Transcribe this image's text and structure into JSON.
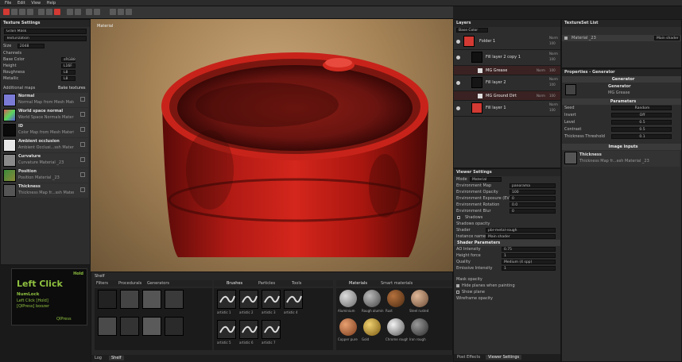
{
  "menu": [
    "File",
    "Edit",
    "View",
    "Help"
  ],
  "left_panel": {
    "title": "Texture Settings",
    "rows": [
      "Grain Mask",
      "Texturization"
    ],
    "size_label": "Size",
    "size_value": "2048",
    "channels_label": "Channels",
    "channels": [
      {
        "label": "Base Color",
        "value": "sRGB8"
      },
      {
        "label": "Height",
        "value": "L16F"
      },
      {
        "label": "Roughness",
        "value": "L8"
      },
      {
        "label": "Metallic",
        "value": "L8"
      }
    ],
    "maps_label": "Additional maps",
    "bake_button": "Bake textures",
    "maps": [
      {
        "name": "Normal",
        "sub": "Normal Map from Mesh Material _23"
      },
      {
        "name": "World space normal",
        "sub": "World Space Normals Material _23"
      },
      {
        "name": "ID",
        "sub": "Color Map from Mesh Material _23"
      },
      {
        "name": "Ambient occlusion",
        "sub": "Ambient Occlusi...ssh Material _23"
      },
      {
        "name": "Curvature",
        "sub": "Curvature Material _23"
      },
      {
        "name": "Position",
        "sub": "Position Material _23"
      },
      {
        "name": "Thickness",
        "sub": "Thickness Map fr...ssh Material _23"
      }
    ]
  },
  "viewport": {
    "label": "Material"
  },
  "hotkey": {
    "corner": "Hold",
    "main": "Left Click",
    "lines": [
      "NumLock",
      "Left Click [Hold]",
      "[QlPress] boozer"
    ],
    "footer": "QIPress"
  },
  "shelf": {
    "panel_label": "Shelf",
    "tabs": [
      "Brushes",
      "Particles",
      "Tools",
      "Materials",
      "Smart materials"
    ],
    "left_tabs": [
      "Filters",
      "Procedurals",
      "Generators"
    ],
    "brush_labels": [
      "artistic 1",
      "artistic 2",
      "artistic 3",
      "artistic 4",
      "artistic 5",
      "artistic 6",
      "artistic 7"
    ],
    "material_labels": [
      "Aluminium",
      "Rough alumini...",
      "Rust",
      "Steel rusted",
      "Copper pure",
      "Gold",
      "Chrome rough",
      "Iron rough"
    ],
    "bottom_tabs": [
      "Log",
      "Shelf"
    ]
  },
  "layers": {
    "title": "Layers",
    "blend_label": "Base Color",
    "items": [
      {
        "name": "Folder 1",
        "blend": "Norm",
        "opacity": "100"
      },
      {
        "name": "Fill layer 2 copy 1",
        "blend": "Norm",
        "opacity": "100"
      },
      {
        "name": "MG Grease",
        "blend": "Norm",
        "opacity": "100"
      },
      {
        "name": "Fill layer 2",
        "blend": "Norm",
        "opacity": "100"
      },
      {
        "name": "MG Ground Dirt",
        "blend": "Norm",
        "opacity": "100"
      },
      {
        "name": "Fill layer 1",
        "blend": "Norm",
        "opacity": "100"
      }
    ]
  },
  "viewer": {
    "title": "Viewer Settings",
    "mode_label": "Mode",
    "mode_value": "Material",
    "rows": [
      {
        "label": "Environment Map",
        "value": "panorama"
      },
      {
        "label": "Environment Opacity",
        "value": "100"
      },
      {
        "label": "Environment Exposure (EV)",
        "value": "0"
      },
      {
        "label": "Environment Rotation",
        "value": "0.0"
      },
      {
        "label": "Environment Blur",
        "value": "0"
      }
    ],
    "shadows_label": "Shadows",
    "shadows_opacity": "Shadows opacity",
    "shader_label": "Shader",
    "shader_value": "pbr-metal-rough",
    "instance_label": "Instance name",
    "instance_value": "Main shader",
    "params_title": "Shader Parameters",
    "params": [
      {
        "label": "AO Intensity",
        "value": "0.75"
      },
      {
        "label": "Height force",
        "value": "1"
      },
      {
        "label": "Quality",
        "value": "Medium (4 spp)"
      },
      {
        "label": "Emissive Intensity",
        "value": "1"
      }
    ],
    "extra": [
      "Mask opacity",
      "Hide planes when painting",
      "Show plane",
      "Wireframe opacity"
    ],
    "bottom_tabs": [
      "Post Effects",
      "Viewer Settings"
    ]
  },
  "texset": {
    "title": "TextureSet List",
    "material": "Material _23",
    "shader": "Main shader"
  },
  "properties": {
    "title": "Properties - Generator",
    "header": "Generator",
    "name_label": "Generator",
    "sub_label": "MG Grease",
    "params_title": "Parameters",
    "params": [
      {
        "label": "Seed",
        "value": "Random"
      },
      {
        "label": "Invert",
        "value": "Off"
      },
      {
        "label": "Level",
        "value": "0.5"
      },
      {
        "label": "Contrast",
        "value": "0.5"
      },
      {
        "label": "Thickness Threshold",
        "value": "0.1"
      }
    ],
    "inputs_title": "Image inputs",
    "input_name": "Thickness",
    "input_sub": "Thickness Map fr...esh Material _23"
  },
  "colors": {
    "accent_red": "#d23a33",
    "panel": "#2d2d2d",
    "background": "#1e1e1e",
    "hotkey_green": "#8fc13f"
  }
}
